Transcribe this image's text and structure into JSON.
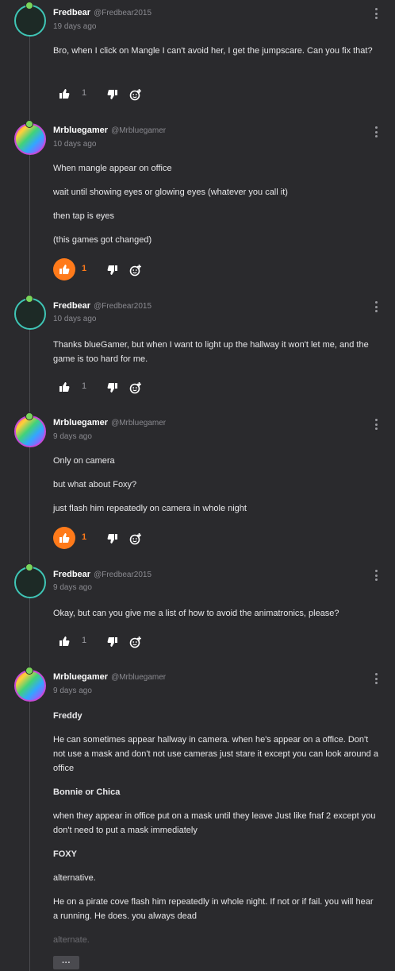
{
  "colors": {
    "accent": "#ff7a1a",
    "background": "#2a2a2d"
  },
  "comments": [
    {
      "author": "Fredbear",
      "handle": "@Fredbear2015",
      "time": "19 days ago",
      "lines": [
        "Bro, when I click on Mangle I can't avoid her, I get the jumpscare. Can you fix that?"
      ],
      "likes": "1",
      "liked": false
    },
    {
      "author": "Mrbluegamer",
      "handle": "@Mrbluegamer",
      "time": "10 days ago",
      "lines": [
        "When mangle appear on office",
        "wait until showing eyes or glowing eyes (whatever you call it)",
        "then tap is eyes",
        "(this games got changed)"
      ],
      "likes": "1",
      "liked": true
    },
    {
      "author": "Fredbear",
      "handle": "@Fredbear2015",
      "time": "10 days ago",
      "lines": [
        "Thanks blueGamer, but when I want to light up the hallway it won't let me, and the game is too hard for me."
      ],
      "likes": "1",
      "liked": false
    },
    {
      "author": "Mrbluegamer",
      "handle": "@Mrbluegamer",
      "time": "9 days ago",
      "lines": [
        "Only on camera",
        "but what about Foxy?",
        "just flash him repeatedly on camera in whole night"
      ],
      "likes": "1",
      "liked": true
    },
    {
      "author": "Fredbear",
      "handle": "@Fredbear2015",
      "time": "9 days ago",
      "lines": [
        "Okay, but can you give me a list of how to avoid the animatronics, please?"
      ],
      "likes": "1",
      "liked": false
    },
    {
      "author": "Mrbluegamer",
      "handle": "@Mrbluegamer",
      "time": "9 days ago",
      "lines": [
        "Freddy",
        "He can sometimes appear hallway in camera. when he's appear on a office. Don't not use a mask and don't not use cameras just stare it except you can look around a office",
        "Bonnie or Chica",
        "when they appear in office put on a mask until they leave Just like fnaf 2 except you don't need to put a mask immediately",
        "FOXY",
        "alternative.",
        "He on a pirate cove flash him repeatedly in whole night. If not or if fail. you will hear a running. He does. you always dead",
        "alternate."
      ]
    }
  ],
  "more_label": "···"
}
